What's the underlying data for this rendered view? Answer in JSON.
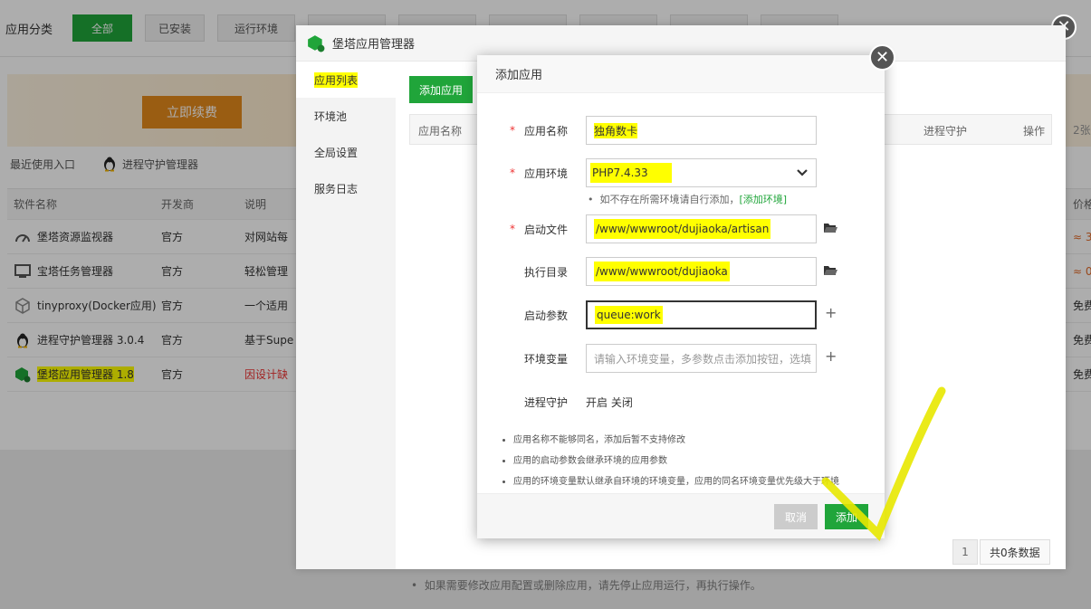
{
  "background": {
    "category_label": "应用分类",
    "categories": [
      {
        "label": "全部",
        "active": true
      },
      {
        "label": "已安装",
        "active": false
      },
      {
        "label": "运行环境",
        "active": false
      }
    ],
    "renew_label": "立即续费",
    "recent_label": "最近使用入口",
    "recent_app": "进程守护管理器",
    "table_headers": [
      "软件名称",
      "开发商",
      "说明",
      "价格"
    ],
    "rows": [
      {
        "name": "堡塔资源监视器",
        "vendor": "官方",
        "desc": "对网站每",
        "price": "≈ 3"
      },
      {
        "name": "宝塔任务管理器",
        "vendor": "官方",
        "desc": "轻松管理",
        "price": "≈ 0"
      },
      {
        "name": "tinyproxy(Docker应用)",
        "vendor": "官方",
        "desc": "一个适用",
        "price": "免费"
      },
      {
        "name": "进程守护管理器 3.0.4",
        "vendor": "官方",
        "desc": "基于Supe",
        "price": "免费"
      },
      {
        "name": "堡塔应用管理器 1.8",
        "vendor": "官方",
        "desc": "因设计缺",
        "price": "免费"
      }
    ]
  },
  "manager": {
    "title": "堡塔应用管理器",
    "sidebar": [
      "应用列表",
      "环境池",
      "全局设置",
      "服务日志"
    ],
    "add_button": "添加应用",
    "table_headers": {
      "name": "应用名称",
      "guard": "进程守护",
      "ops": "操作"
    },
    "count_edge": "2张",
    "pager": {
      "page": "1",
      "info": "共0条数据"
    },
    "tip": "如果需要修改应用配置或删除应用，请先停止应用运行，再执行操作。"
  },
  "add_dialog": {
    "title": "添加应用",
    "fields": {
      "name": {
        "label": "应用名称",
        "value": "独角数卡"
      },
      "env": {
        "label": "应用环境",
        "value": "PHP7.4.33"
      },
      "start_file": {
        "label": "启动文件",
        "value": "/www/wwwroot/dujiaoka/artisan"
      },
      "exec_dir": {
        "label": "执行目录",
        "value": "/www/wwwroot/dujiaoka"
      },
      "args": {
        "label": "启动参数",
        "value": "queue:work"
      },
      "env_vars": {
        "label": "环境变量",
        "placeholder": "请输入环境变量，多参数点击添加按钮，选填"
      },
      "guard": {
        "label": "进程守护",
        "on": "开启",
        "off": "关闭"
      }
    },
    "env_note": "如不存在所需环境请自行添加，",
    "env_link": "[添加环境]",
    "notes": [
      "应用名称不能够同名，添加后暂不支持修改",
      "应用的启动参数会继承环境的应用参数",
      "应用的环境变量默认继承自环境的环境变量，应用的同名环境变量优先级大于环境"
    ],
    "cancel": "取消",
    "confirm": "添加"
  },
  "colors": {
    "green": "#20a53a",
    "highlight": "#ffff00",
    "orange": "#e48a1b"
  }
}
